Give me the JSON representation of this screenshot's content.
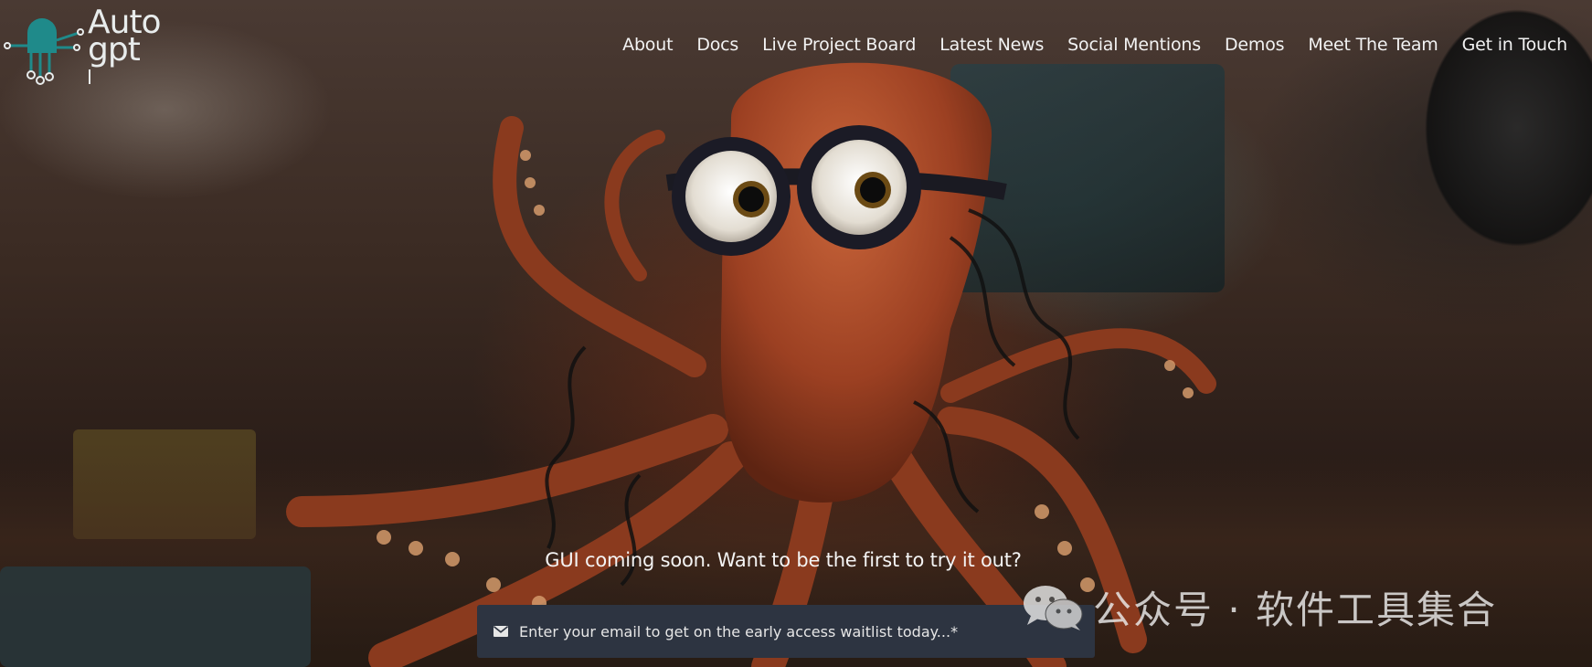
{
  "brand": {
    "logo_line1": "Auto",
    "logo_line2": "gpt",
    "logo_color": "#1f8a8a"
  },
  "nav": {
    "items": [
      {
        "label": "About"
      },
      {
        "label": "Docs"
      },
      {
        "label": "Live Project Board"
      },
      {
        "label": "Latest News"
      },
      {
        "label": "Social Mentions"
      },
      {
        "label": "Demos"
      },
      {
        "label": "Meet The Team"
      },
      {
        "label": "Get in Touch"
      }
    ]
  },
  "hero": {
    "cta_heading": "GUI coming soon. Want to be the first to try it out?",
    "email_placeholder": "Enter your email to get on the early access waitlist today...*",
    "email_icon": "envelope-icon",
    "email_bar_color": "#2d3441"
  },
  "watermark": {
    "text": "公众号 · 软件工具集合",
    "icon": "wechat-icon"
  }
}
